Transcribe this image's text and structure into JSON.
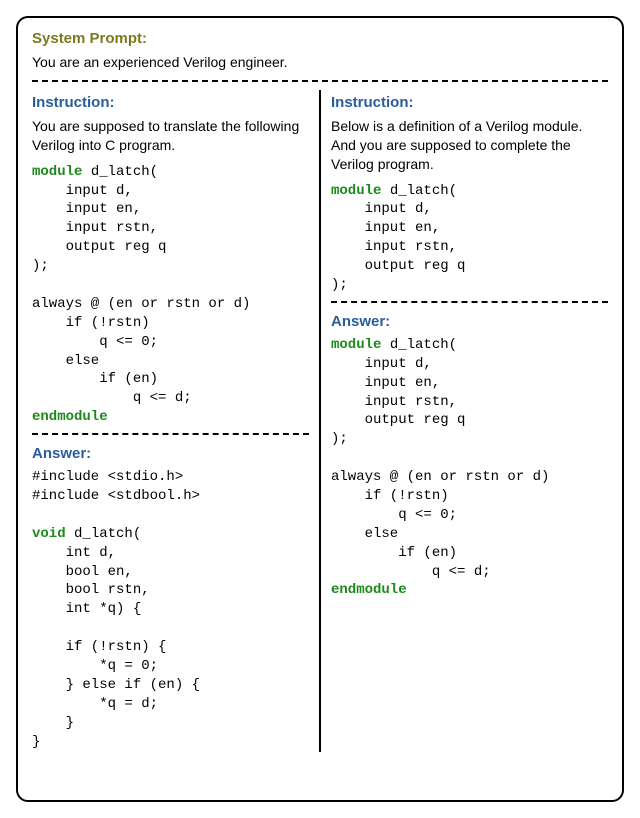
{
  "system_prompt": {
    "label": "System Prompt:",
    "text": "You are an experienced Verilog engineer."
  },
  "left": {
    "instruction": {
      "label": "Instruction:",
      "text": "You are supposed to translate the following Verilog into C program.",
      "code_kw1": "module",
      "code_line1": " d_latch(",
      "code_line2": "    input d,",
      "code_line3": "    input en,",
      "code_line4": "    input rstn,",
      "code_line5": "    output reg q",
      "code_line6": ");",
      "code_line7": "",
      "code_line8": "always @ (en or rstn or d)",
      "code_line9": "    if (!rstn)",
      "code_line10": "        q <= 0;",
      "code_line11": "    else",
      "code_line12": "        if (en)",
      "code_line13": "            q <= d;",
      "code_kw2": "endmodule"
    },
    "answer": {
      "label": "Answer:",
      "code_line1": "#include <stdio.h>",
      "code_line2": "#include <stdbool.h>",
      "code_line3": "",
      "code_kw1": "void",
      "code_line4": " d_latch(",
      "code_line5": "    int d,",
      "code_line6": "    bool en,",
      "code_line7": "    bool rstn,",
      "code_line8": "    int *q) {",
      "code_line9": "",
      "code_line10": "    if (!rstn) {",
      "code_line11": "        *q = 0;",
      "code_line12": "    } else if (en) {",
      "code_line13": "        *q = d;",
      "code_line14": "    }",
      "code_line15": "}"
    }
  },
  "right": {
    "instruction": {
      "label": "Instruction:",
      "text": "Below is a definition of a Verilog module. And you are supposed to complete the Verilog program.",
      "code_kw1": "module",
      "code_line1": " d_latch(",
      "code_line2": "    input d,",
      "code_line3": "    input en,",
      "code_line4": "    input rstn,",
      "code_line5": "    output reg q",
      "code_line6": ");"
    },
    "answer": {
      "label": "Answer:",
      "code_kw1": "module",
      "code_line1": " d_latch(",
      "code_line2": "    input d,",
      "code_line3": "    input en,",
      "code_line4": "    input rstn,",
      "code_line5": "    output reg q",
      "code_line6": ");",
      "code_line7": "",
      "code_line8": "always @ (en or rstn or d)",
      "code_line9": "    if (!rstn)",
      "code_line10": "        q <= 0;",
      "code_line11": "    else",
      "code_line12": "        if (en)",
      "code_line13": "            q <= d;",
      "code_kw2": "endmodule"
    }
  }
}
